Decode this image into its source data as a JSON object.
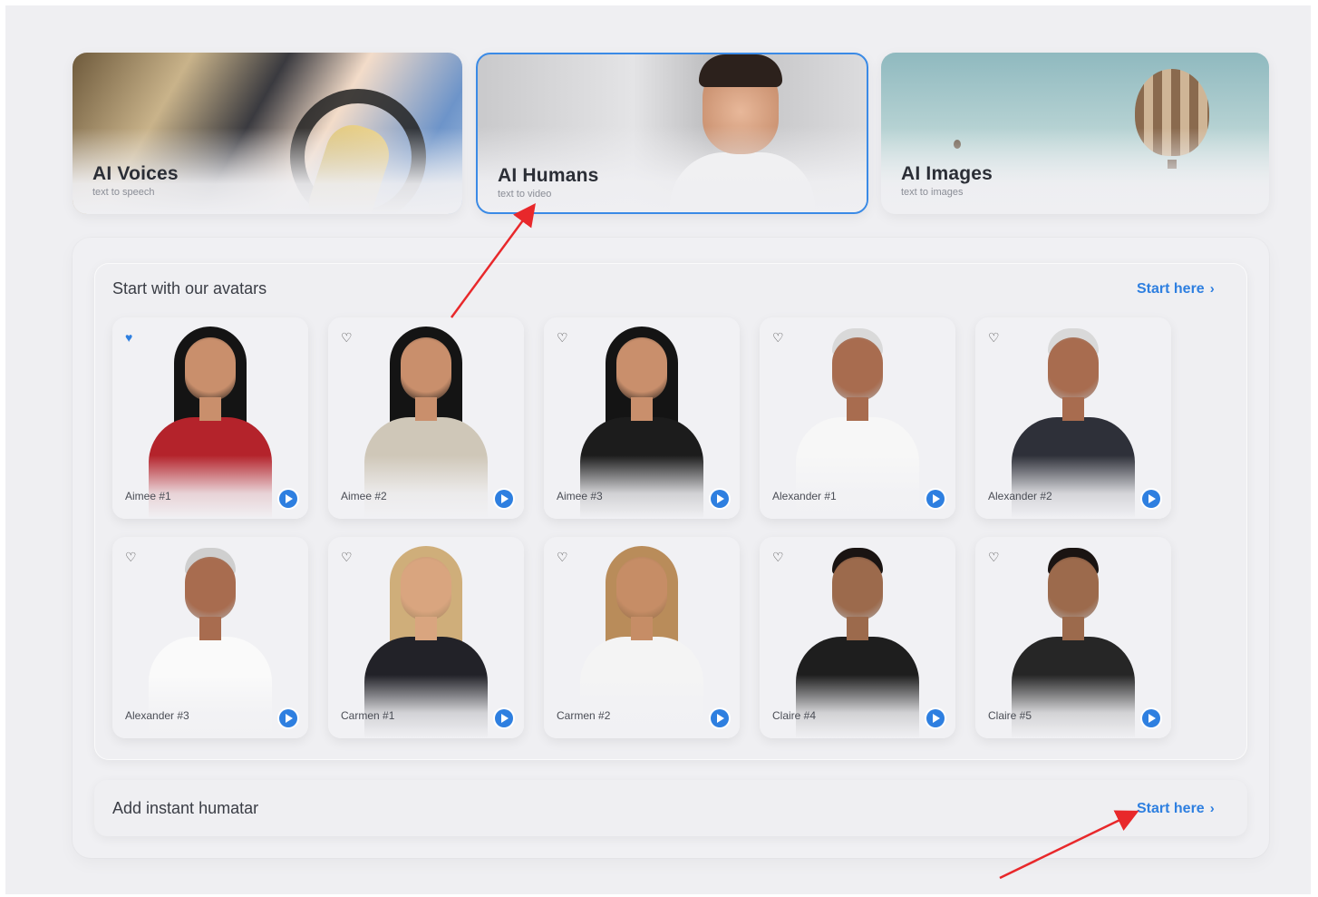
{
  "categories": [
    {
      "title": "AI Voices",
      "subtitle": "text to speech",
      "selected": false
    },
    {
      "title": "AI Humans",
      "subtitle": "text to video",
      "selected": true
    },
    {
      "title": "AI Images",
      "subtitle": "text to images",
      "selected": false
    }
  ],
  "avatars_section": {
    "title": "Start with our avatars",
    "link_label": "Start here",
    "items": [
      {
        "name": "Aimee #1",
        "favorite": true
      },
      {
        "name": "Aimee #2",
        "favorite": false
      },
      {
        "name": "Aimee #3",
        "favorite": false
      },
      {
        "name": "Alexander #1",
        "favorite": false
      },
      {
        "name": "Alexander #2",
        "favorite": false
      },
      {
        "name": "Alexander #3",
        "favorite": false
      },
      {
        "name": "Carmen #1",
        "favorite": false
      },
      {
        "name": "Carmen #2",
        "favorite": false
      },
      {
        "name": "Claire #4",
        "favorite": false
      },
      {
        "name": "Claire #5",
        "favorite": false
      }
    ]
  },
  "humatar_section": {
    "title": "Add instant humatar",
    "link_label": "Start here"
  },
  "colors": {
    "accent": "#2e7fe0",
    "annotation_arrow": "#e8282b",
    "background": "#efeff2"
  }
}
